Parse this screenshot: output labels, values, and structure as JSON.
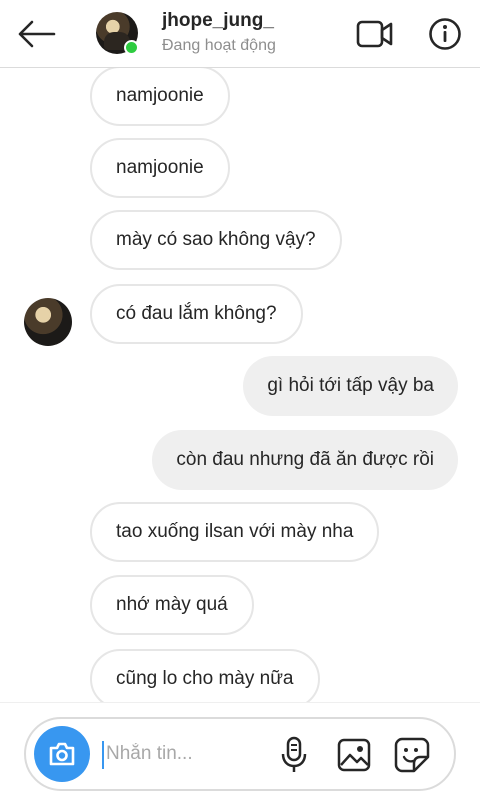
{
  "header": {
    "username": "jhope_jung_",
    "status": "Đang hoạt động",
    "icons": {
      "back": "arrow-left-icon",
      "video": "video-camera-icon",
      "info": "info-circle-icon"
    }
  },
  "messages": [
    {
      "direction": "incoming",
      "text": "namjoonie"
    },
    {
      "direction": "incoming",
      "text": "namjoonie"
    },
    {
      "direction": "incoming",
      "text": "mày có sao không vậy?"
    },
    {
      "direction": "incoming",
      "text": "có đau lắm không?"
    },
    {
      "direction": "outgoing",
      "text": "gì hỏi tới tấp vậy ba"
    },
    {
      "direction": "outgoing",
      "text": "còn đau nhưng đã ăn được rồi"
    },
    {
      "direction": "incoming",
      "text": "tao xuống ilsan với mày nha"
    },
    {
      "direction": "incoming",
      "text": "nhớ mày quá"
    },
    {
      "direction": "incoming",
      "text": "cũng lo cho mày nữa"
    }
  ],
  "composer": {
    "placeholder": "Nhắn tin...",
    "value": "",
    "icons": {
      "camera": "camera-icon",
      "mic": "microphone-icon",
      "gallery": "image-icon",
      "sticker": "sticker-icon"
    }
  },
  "colors": {
    "accent": "#3897f0",
    "online": "#2ecc40",
    "outgoing_bubble": "#efefef",
    "incoming_border": "#e6e6e6"
  }
}
